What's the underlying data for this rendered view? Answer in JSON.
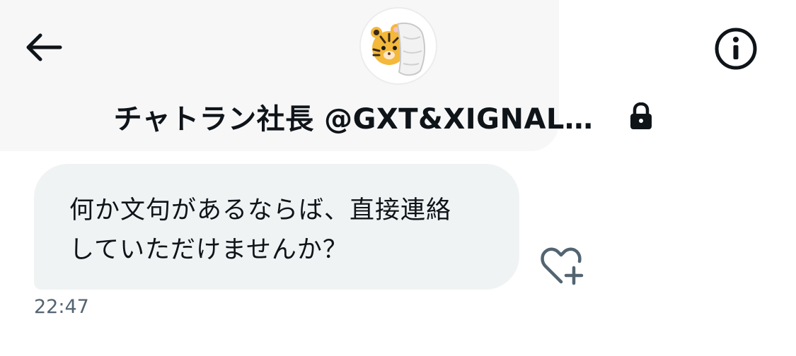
{
  "header": {
    "title": "チャトラン社長 @GXT&XIGNAL…",
    "back_icon": "arrow-left-icon",
    "info_icon": "info-circle-icon",
    "lock_icon": "lock-icon",
    "avatar_icon": "tiger-avatar"
  },
  "message": {
    "text": "何か文句があるならば、直接連絡\nしていただけませんか？",
    "timestamp": "22:47",
    "reaction_icon": "heart-plus-icon"
  },
  "colors": {
    "bubble": "#eff3f4",
    "text": "#0f1419",
    "secondary_text": "#536471",
    "icon": "#536471"
  }
}
